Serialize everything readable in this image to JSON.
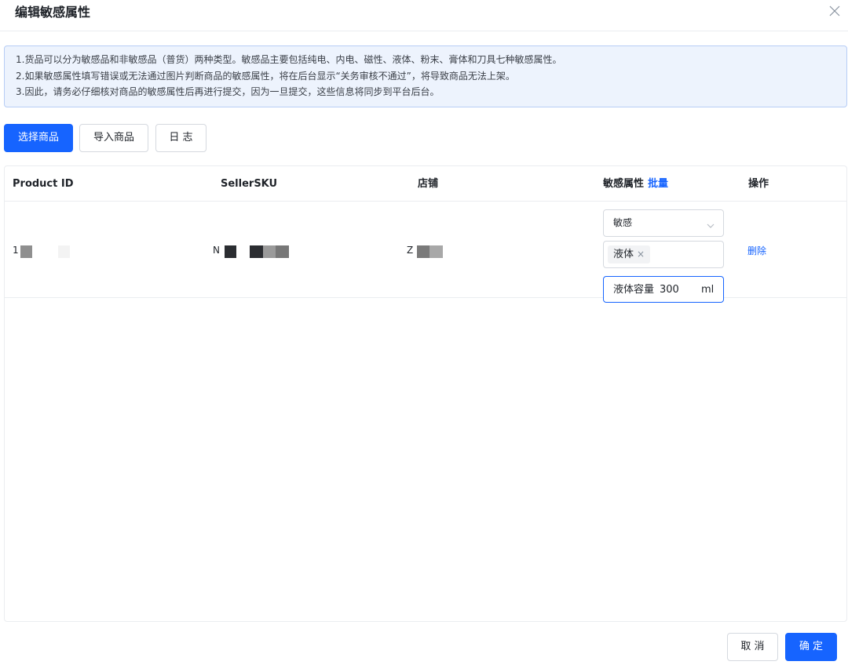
{
  "dialog": {
    "title": "编辑敏感属性"
  },
  "icons": {
    "close": "close-icon",
    "chevron": "chevron-down-icon",
    "tag_remove": "x-icon"
  },
  "notice": {
    "lines": [
      "1.货品可以分为敏感品和非敏感品（普货）两种类型。敏感品主要包括纯电、内电、磁性、液体、粉末、膏体和刀具七种敏感属性。",
      "2.如果敏感属性填写错误或无法通过图片判断商品的敏感属性，将在后台显示“关务审核不通过”，将导致商品无法上架。",
      "3.因此，请务必仔细核对商品的敏感属性后再进行提交，因为一旦提交，这些信息将同步到平台后台。"
    ]
  },
  "toolbar": {
    "select_products": "选择商品",
    "import_products": "导入商品",
    "log": "日 志"
  },
  "table": {
    "columns": {
      "product_id": "Product ID",
      "seller_sku": "SellerSKU",
      "store": "店铺",
      "sensitive_attr": "敏感属性",
      "batch": "批量",
      "action": "操作"
    },
    "rows": [
      {
        "product_id_prefix": "1",
        "seller_sku_prefix": "N",
        "store_prefix": "Z",
        "sensitivity": "敏感",
        "attribute_tag": "液体",
        "tag_remove": "×",
        "volume_label": "液体容量",
        "volume_value": "300",
        "volume_unit": "ml",
        "delete_label": "删除"
      }
    ]
  },
  "footer": {
    "cancel": "取 消",
    "confirm": "确 定"
  },
  "colors": {
    "primary": "#1664ff",
    "notice_bg": "#edf3fd",
    "notice_border": "#b7cdf6",
    "border": "#ebedf0",
    "mask_dark": "#2b2d31",
    "mask_gray": "#9a9a9a"
  }
}
